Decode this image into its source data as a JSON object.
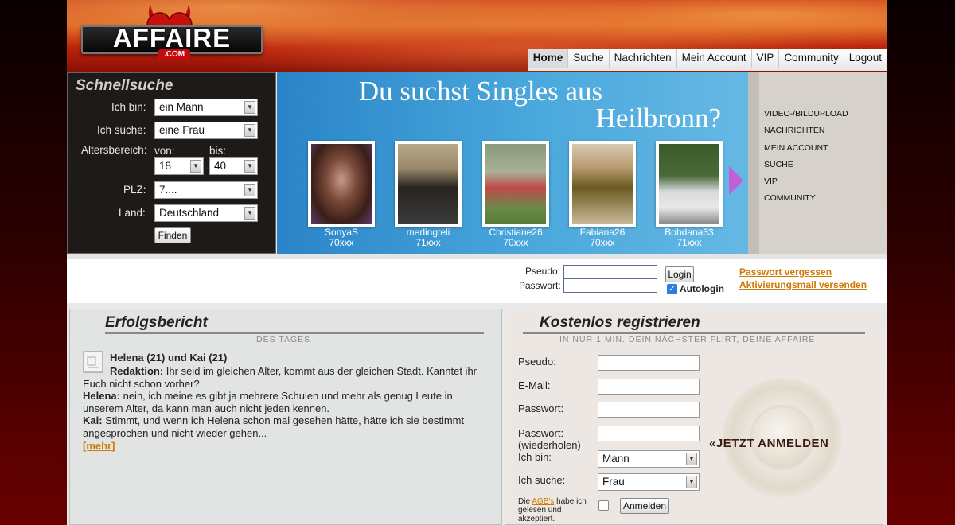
{
  "header": {
    "logo_text": "AFFAIRE",
    "logo_sub": ".COM",
    "nav": [
      "Home",
      "Suche",
      "Nachrichten",
      "Mein Account",
      "VIP",
      "Community",
      "Logout"
    ]
  },
  "quick_search": {
    "title": "Schnellsuche",
    "i_am_label": "Ich bin:",
    "i_am_value": "ein Mann",
    "seeking_label": "Ich suche:",
    "seeking_value": "eine Frau",
    "age_label": "Altersbereich:",
    "from_label": "von:",
    "to_label": "bis:",
    "age_from": "18",
    "age_to": "40",
    "zip_label": "PLZ:",
    "zip_value": "7....",
    "country_label": "Land:",
    "country_value": "Deutschland",
    "find_button": "Finden"
  },
  "banner": {
    "headline_1": "Du suchst Singles aus",
    "headline_2": "Heilbronn?",
    "profiles": [
      {
        "name": "SonyaS",
        "location": "70xxx"
      },
      {
        "name": "merlingteli",
        "location": "71xxx"
      },
      {
        "name": "Christiane26",
        "location": "70xxx"
      },
      {
        "name": "Fabiana26",
        "location": "70xxx"
      },
      {
        "name": "Bohdana33",
        "location": "71xxx"
      }
    ]
  },
  "side_menu": [
    "VIDEO-/BILDUPLOAD",
    "NACHRICHTEN",
    "MEIN ACCOUNT",
    "SUCHE",
    "VIP",
    "COMMUNITY"
  ],
  "login": {
    "pseudo_label": "Pseudo:",
    "password_label": "Passwort:",
    "login_button": "Login",
    "autologin_label": "Autologin",
    "forgot_link": "Passwort vergessen",
    "activation_link": "Aktivierungsmail versenden"
  },
  "story": {
    "title": "Erfolgsbericht",
    "subtitle": "DES TAGES",
    "couple": "Helena (21) und Kai (21)",
    "q_label": "Redaktion:",
    "q_text": "Ihr seid im gleichen Alter, kommt aus der gleichen Stadt. Kanntet ihr",
    "q_text2": "Euch nicht schon vorher?",
    "h_label": "Helena:",
    "h_text": "nein, ich meine es gibt ja mehrere Schulen und mehr als genug Leute in",
    "h_text2": "unserem Alter, da kann man auch nicht jeden kennen.",
    "k_label": "Kai:",
    "k_text": "Stimmt, und wenn ich Helena schon mal gesehen hätte, hätte ich sie bestimmt",
    "k_text2": "angesprochen und nicht wieder gehen...",
    "more_link": "[mehr]"
  },
  "register": {
    "title": "Kostenlos registrieren",
    "subtitle": "IN NUR 1 MIN. DEIN NÄCHSTER FLIRT, DEINE AFFAIRE",
    "pseudo_label": "Pseudo:",
    "email_label": "E-Mail:",
    "password_label": "Passwort:",
    "password2_label_1": "Passwort:",
    "password2_label_2": "(wiederholen)",
    "i_am_label": "Ich bin:",
    "i_am_value": "Mann",
    "seeking_label": "Ich suche:",
    "seeking_value": "Frau",
    "agb_prefix": "Die",
    "agb_link": "AGB's",
    "agb_suffix": "habe ich",
    "agb_line2": "gelesen und",
    "agb_line3": "akzeptiert.",
    "submit_button": "Anmelden",
    "cta": "«JETZT ANMELDEN"
  }
}
